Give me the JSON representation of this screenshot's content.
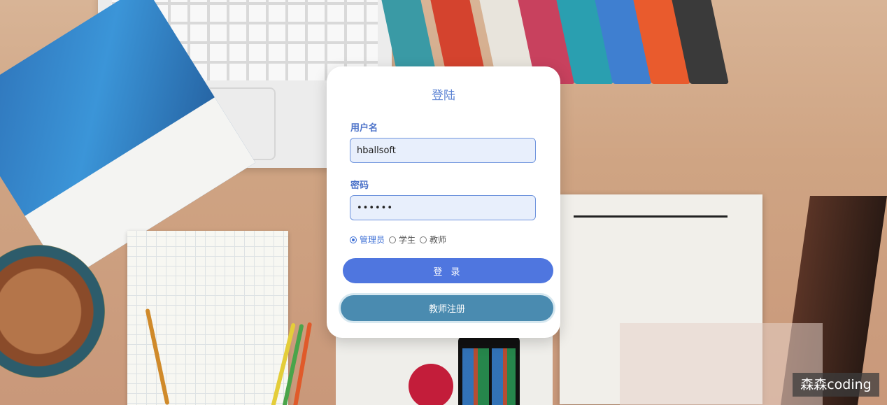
{
  "login": {
    "title": "登陆",
    "username_label": "用户名",
    "username_value": "hballsoft",
    "password_label": "密码",
    "password_value": "••••••",
    "roles": [
      {
        "label": "管理员",
        "selected": true
      },
      {
        "label": "学生",
        "selected": false
      },
      {
        "label": "教师",
        "selected": false
      }
    ],
    "login_button": "登 录",
    "register_button": "教师注册"
  },
  "watermark": "森森coding",
  "colors": {
    "accent": "#4f76df",
    "label": "#4d73c9",
    "register_button": "#4a8bb0",
    "field_bg": "#e8effc"
  }
}
